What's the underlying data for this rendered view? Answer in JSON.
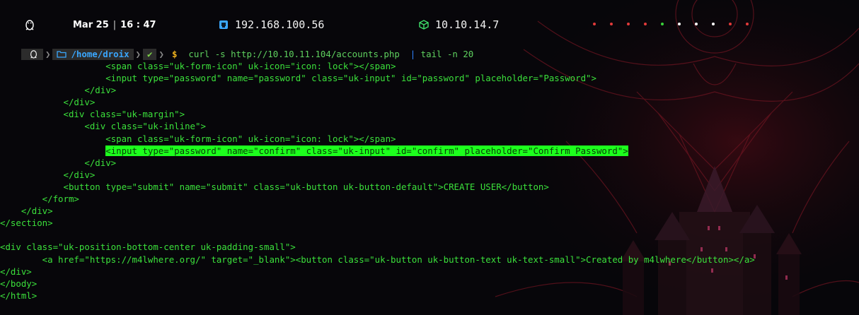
{
  "status_bar": {
    "date": "Mar 25",
    "time": "16 : 47",
    "ip_local": "192.168.100.56",
    "ip_vpn": "10.10.14.7",
    "workspace_dot_colors": [
      "#e23a3a",
      "#e23a3a",
      "#e23a3a",
      "#e23a3a",
      "#3ad23a",
      "#ffffff",
      "#ffffff",
      "#ffffff",
      "#e23a3a",
      "#e23a3a"
    ]
  },
  "prompt": {
    "path": "/home/droix",
    "check": "✔",
    "dollar": "$",
    "command_part1": "curl -s http://10.10.11.104/accounts.php",
    "pipe": "|",
    "command_part2": "tail -n 20"
  },
  "output_lines": [
    "                    <span class=\"uk-form-icon\" uk-icon=\"icon: lock\"></span>",
    "                    <input type=\"password\" name=\"password\" class=\"uk-input\" id=\"password\" placeholder=\"Password\">",
    "                </div>",
    "            </div>",
    "            <div class=\"uk-margin\">",
    "                <div class=\"uk-inline\">",
    "                    <span class=\"uk-form-icon\" uk-icon=\"icon: lock\"></span>",
    "                    <input type=\"password\" name=\"confirm\" class=\"uk-input\" id=\"confirm\" placeholder=\"Confirm Password\">",
    "                </div>",
    "            </div>",
    "            <button type=\"submit\" name=\"submit\" class=\"uk-button uk-button-default\">CREATE USER</button>",
    "        </form>",
    "    </div>",
    "</section>",
    "",
    "<div class=\"uk-position-bottom-center uk-padding-small\">",
    "        <a href=\"https://m4lwhere.org/\" target=\"_blank\"><button class=\"uk-button uk-button-text uk-text-small\">Created by m4lwhere</button></a>",
    "</div>",
    "</body>",
    "</html>"
  ],
  "highlighted_line_index": 7,
  "colors": {
    "terminal_text": "#3be03b",
    "highlight": "#1dff1d",
    "path": "#3aa7ff",
    "pipe": "#2f82ff",
    "dollar": "#f0b21e"
  }
}
